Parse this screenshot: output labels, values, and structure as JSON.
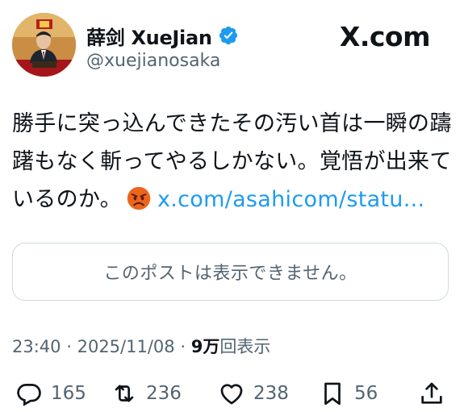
{
  "author": {
    "display_name": "薛剑 XueJian",
    "handle": "@xuejianosaka",
    "verified": true
  },
  "brand": {
    "label": "X.com"
  },
  "tweet": {
    "lines": [
      "勝手に突っ込んできたその汚い首は一瞬の躊",
      "躇もなく斬ってやるしかない。覚悟が出来て",
      "いるのか。"
    ],
    "emoji": "angry-face",
    "link_text": "x.com/asahicom/statu..."
  },
  "quoted_post": {
    "unavailable_text": "このポストは表示できません。"
  },
  "meta": {
    "time": "23:40",
    "separator": "·",
    "date": "2025/11/08",
    "views_count": "9万",
    "views_label": "回表示"
  },
  "actions": {
    "replies": "165",
    "reposts": "236",
    "likes": "238",
    "bookmarks": "56"
  },
  "colors": {
    "text": "#0f1419",
    "secondary": "#536471",
    "link": "#1d9bf0",
    "border": "#cfd9de",
    "verified": "#1d9bf0"
  }
}
